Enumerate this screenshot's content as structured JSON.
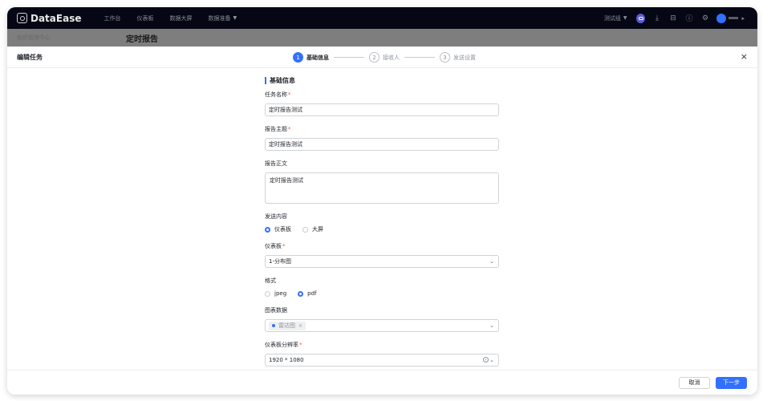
{
  "app": {
    "brand": "DataEase",
    "nav": [
      "工作台",
      "仪表板",
      "数据大屏",
      "数据准备"
    ],
    "nav_dropdown_index": 3,
    "group_select": "测试组",
    "toolbar_icons": [
      "ai-assistant-icon",
      "download-icon",
      "toolbox-icon",
      "help-icon",
      "settings-icon"
    ],
    "user_menu_flag": "▸"
  },
  "subbar": {
    "org_label": "组织管理中心",
    "page_title": "定时报告"
  },
  "drawer": {
    "title": "编辑任务",
    "close_icon": "×",
    "steps": [
      {
        "num": "1",
        "label": "基础信息",
        "active": true
      },
      {
        "num": "2",
        "label": "接收人",
        "active": false
      },
      {
        "num": "3",
        "label": "发送设置",
        "active": false
      }
    ]
  },
  "form": {
    "section_title": "基础信息",
    "task_name": {
      "label": "任务名称",
      "required": "*",
      "value": "定时报告测试"
    },
    "report_subject": {
      "label": "报告主题",
      "required": "*",
      "value": "定时报告测试"
    },
    "report_body": {
      "label": "报告正文",
      "value": "定时报告测试"
    },
    "send_content": {
      "label": "发送内容",
      "options": [
        {
          "label": "仪表板",
          "checked": true
        },
        {
          "label": "大屏",
          "checked": false
        }
      ]
    },
    "dashboard": {
      "label": "仪表板",
      "required": "*",
      "value": "1-分布图"
    },
    "format": {
      "label": "格式",
      "options": [
        {
          "label": "jpeg",
          "checked": false
        },
        {
          "label": "pdf",
          "checked": true
        }
      ]
    },
    "chart_data": {
      "label": "图表数据",
      "tags": [
        "雷达图"
      ],
      "tag_remove": "×"
    },
    "resolution": {
      "label": "仪表板分辨率",
      "required": "*",
      "value": "1920 * 1080"
    }
  },
  "footer": {
    "cancel_label": "取消",
    "next_label": "下一步"
  },
  "colors": {
    "primary": "#3370ff",
    "topbar": "#050814",
    "required": "#f54a45"
  }
}
